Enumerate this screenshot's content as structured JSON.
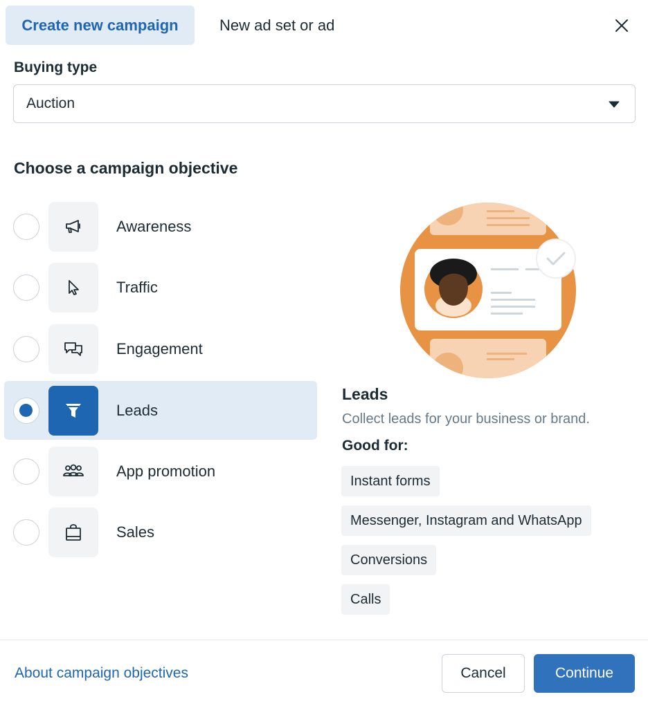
{
  "tabs": {
    "active_label": "Create new campaign",
    "inactive_label": "New ad set or ad",
    "close_icon": "close-icon"
  },
  "buying_type": {
    "label": "Buying type",
    "selected": "Auction",
    "caret_icon": "caret-down-icon"
  },
  "objective": {
    "heading": "Choose a campaign objective",
    "selected": "Leads",
    "items": [
      {
        "label": "Awareness",
        "icon": "megaphone-icon",
        "selected": false
      },
      {
        "label": "Traffic",
        "icon": "cursor-icon",
        "selected": false
      },
      {
        "label": "Engagement",
        "icon": "chat-bubbles-icon",
        "selected": false
      },
      {
        "label": "Leads",
        "icon": "funnel-icon",
        "selected": true
      },
      {
        "label": "App promotion",
        "icon": "people-icon",
        "selected": false
      },
      {
        "label": "Sales",
        "icon": "shopping-bag-icon",
        "selected": false
      }
    ]
  },
  "detail": {
    "title": "Leads",
    "description": "Collect leads for your business or brand.",
    "good_for_label": "Good for:",
    "chips": [
      "Instant forms",
      "Messenger, Instagram and WhatsApp",
      "Conversions",
      "Calls"
    ]
  },
  "footer": {
    "about_link": "About campaign objectives",
    "cancel_label": "Cancel",
    "continue_label": "Continue"
  },
  "colors": {
    "accent": "#1f66b2",
    "accent_bg": "#e0ebf5",
    "primary_button": "#3172bc",
    "illustration_orange": "#e89243"
  }
}
